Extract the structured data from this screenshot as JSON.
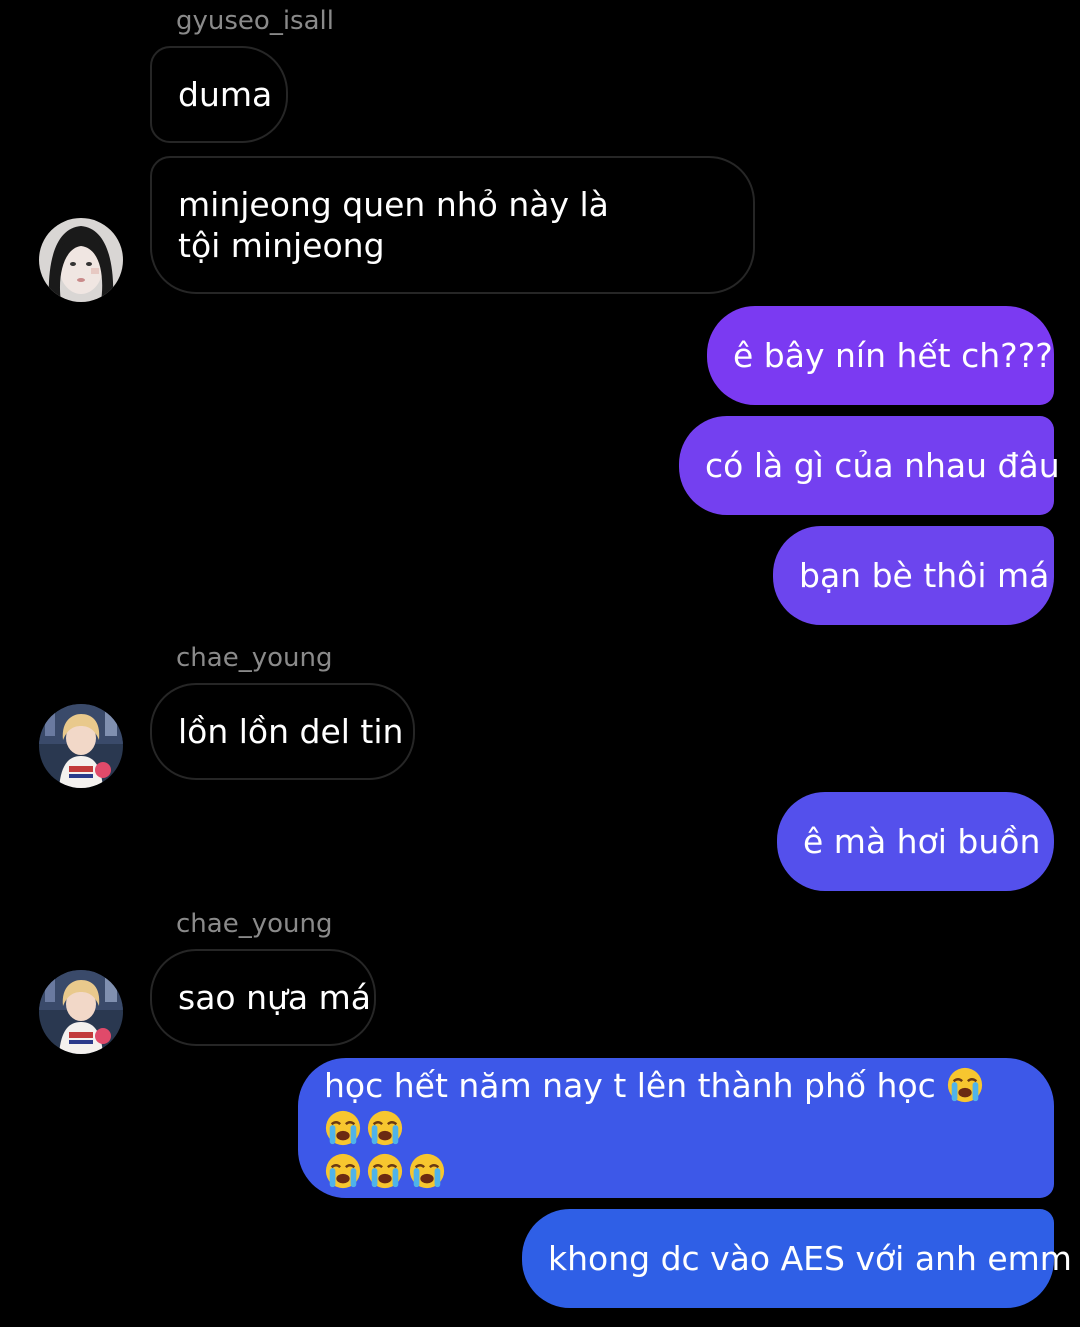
{
  "messages": [
    {
      "sender": "gyuseo_isall",
      "text": "duma"
    },
    {
      "text": "minjeong quen nhỏ này là tội minjeong"
    },
    {
      "text": "ê bây nín hết ch???"
    },
    {
      "text": "có là gì của nhau đâu"
    },
    {
      "text": "bạn bè thôi má"
    },
    {
      "sender": "chae_young",
      "text": "lồn lồn del tin"
    },
    {
      "text": "ê mà hơi buồn"
    },
    {
      "sender": "chae_young",
      "text": "sao nựa má"
    },
    {
      "text": "học hết năm nay t lên thành phố học",
      "emoji_count": 6
    },
    {
      "text": "khong dc vào AES với anh emm"
    }
  ],
  "icons": {
    "emoji": "loudly-crying-face-icon",
    "avatar_1": "user-avatar-gyuseo",
    "avatar_2": "user-avatar-chae-young"
  },
  "colors": {
    "background": "#000000",
    "incoming_border": "#262626",
    "sender_name": "#8a8a8a",
    "outgoing_purple": "#7a3cf0",
    "outgoing_blue": "#2f5fe6"
  }
}
